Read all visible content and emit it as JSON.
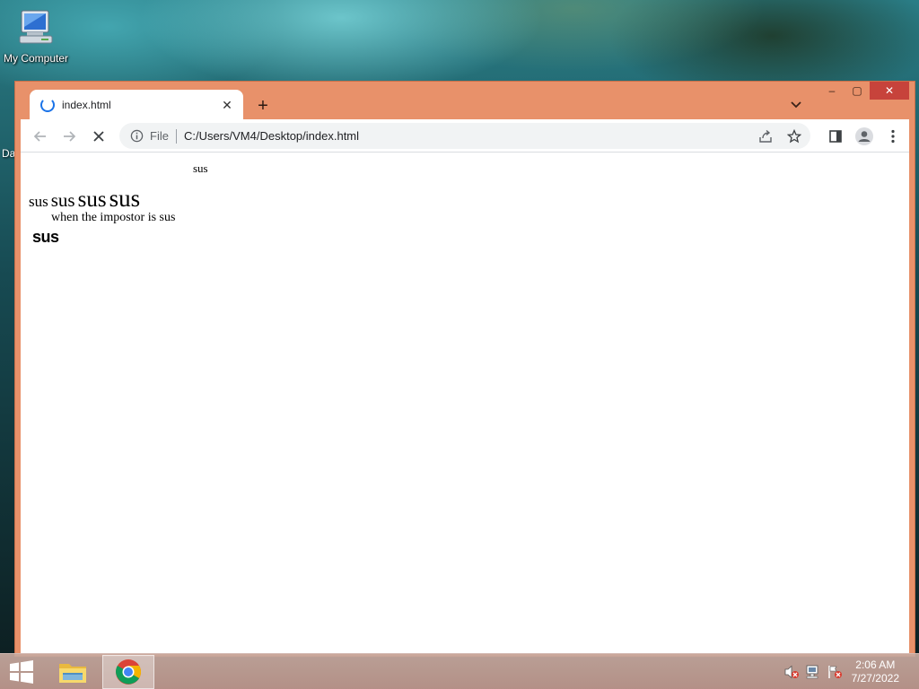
{
  "desktop": {
    "icons": [
      {
        "label": "My Computer",
        "icon": "computer-icon"
      }
    ],
    "partial_label": "Da"
  },
  "window": {
    "tab": {
      "title": "index.html",
      "icon": "loading-spinner-icon"
    },
    "new_tab_label": "+",
    "caption": {
      "minimize": "–",
      "maximize": "▢",
      "close": "✕"
    },
    "omnibox": {
      "scheme": "File",
      "url": "C:/Users/VM4/Desktop/index.html"
    }
  },
  "page": {
    "line1": "sus",
    "line2": [
      "sus",
      "sus",
      "sus",
      "sus"
    ],
    "line3": "when the impostor is sus",
    "line4": "sus"
  },
  "taskbar": {
    "apps": [
      {
        "name": "file-explorer",
        "icon": "folder-icon",
        "active": false
      },
      {
        "name": "chrome",
        "icon": "chrome-icon",
        "active": true
      }
    ],
    "clock": {
      "time": "2:06 AM",
      "date": "7/27/2022"
    }
  },
  "colors": {
    "window_frame": "#e8916a",
    "close_button": "#c7433b",
    "accent": "#1a73e8"
  }
}
